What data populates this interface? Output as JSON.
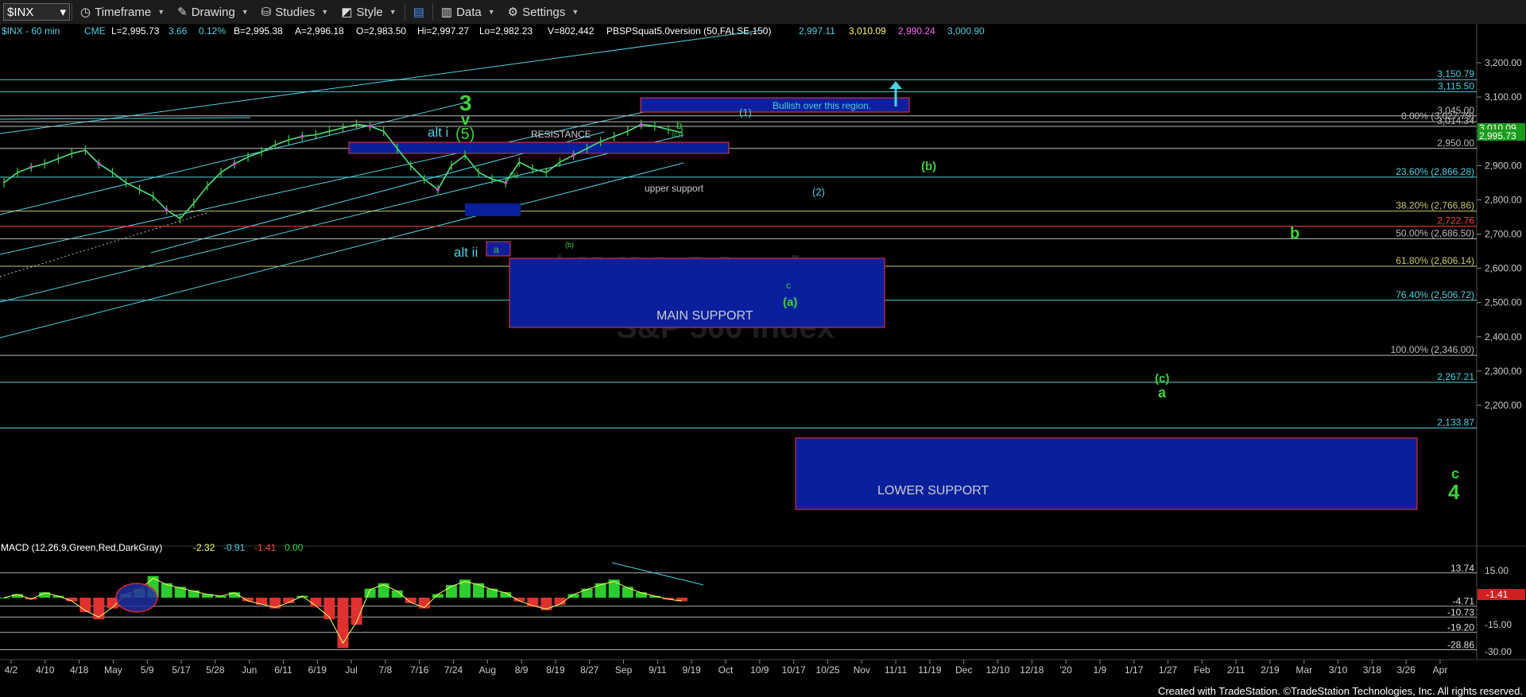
{
  "toolbar": {
    "symbol": "$INX",
    "timeframe": "Timeframe",
    "drawing": "Drawing",
    "studies": "Studies",
    "style": "Style",
    "data": "Data",
    "settings": "Settings"
  },
  "header": {
    "title": "$INX - 60 min",
    "exchange": "CME",
    "last": "L=2,995.73",
    "change": "3.66",
    "change_pct": "0.12%",
    "bid": "B=2,995.38",
    "ask": "A=2,996.18",
    "open": "O=2,983.50",
    "high": "Hi=2,997.27",
    "low": "Lo=2,982.23",
    "volume": "V=802,442",
    "study": "PBSPSquat5.0version (50,FALSE,150)",
    "study_v1": "2,997.11",
    "study_v2": "3,010.09",
    "study_v3": "2,990.24",
    "study_v4": "3,000.90"
  },
  "macd_header": {
    "label": "MACD (12,26,9,Green,Red,DarkGray)",
    "v1": "-2.32",
    "v2": "-0.91",
    "v3": "-1.41",
    "v4": "0.00"
  },
  "watermark": {
    "symbol": "$INX 60min",
    "name": "S&P 500 Index"
  },
  "zones": {
    "resistance": "RESISTANCE",
    "main_support": "MAIN SUPPORT",
    "lower_support": "LOWER SUPPORT",
    "bullish": "Bullish over this region.",
    "upper_support": "upper support"
  },
  "wave_labels": {
    "w3": "3",
    "wv": "v",
    "w5": "(5)",
    "alt_i": "alt i",
    "alt_ii": "alt ii",
    "wa_small": "a",
    "wb": "b",
    "wc_top": "(c)",
    "wa_small2": "(a)",
    "wb_small": "(b)",
    "w1": "(1)",
    "w2": "(2)",
    "wb_paren": "(b)",
    "wb_big": "b",
    "wc_mid": "c",
    "wa_paren": "(a)",
    "wc_paren": "(c)",
    "wa_big": "a",
    "wc_big": "c",
    "w4": "4"
  },
  "price_scale": {
    "ticks": [
      "3,200.00",
      "3,100.00",
      "3,000.00",
      "2,900.00",
      "2,800.00",
      "2,700.00",
      "2,600.00",
      "2,500.00",
      "2,400.00",
      "2,300.00",
      "2,200.00"
    ],
    "last_price": "2,995.73",
    "tag_green": "3,010.09"
  },
  "levels": [
    {
      "label": "3,150.79",
      "value": 3150.79,
      "color": "#4fd1e0"
    },
    {
      "label": "3,115.50",
      "value": 3115.5,
      "color": "#4fd1e0"
    },
    {
      "label": "3,045.00",
      "value": 3045.0,
      "color": "#bbbbbb"
    },
    {
      "label": "0.00% (3,027.79)",
      "value": 3027.79,
      "color": "#bbbbbb"
    },
    {
      "label": "3,014.34",
      "value": 3014.34,
      "color": "#bbbbbb"
    },
    {
      "label": "2,950.00",
      "value": 2950.0,
      "color": "#bbbbbb"
    },
    {
      "label": "23.60% (2,866.28)",
      "value": 2866.28,
      "color": "#4fd1e0"
    },
    {
      "label": "38.20% (2,766.86)",
      "value": 2766.86,
      "color": "#c8c864"
    },
    {
      "label": "2,722.76",
      "value": 2722.76,
      "color": "#ff4040"
    },
    {
      "label": "50.00% (2,686.50)",
      "value": 2686.5,
      "color": "#bbbbbb"
    },
    {
      "label": "61.80% (2,606.14)",
      "value": 2606.14,
      "color": "#c8c864"
    },
    {
      "label": "76.40% (2,506.72)",
      "value": 2506.72,
      "color": "#4fd1e0"
    },
    {
      "label": "100.00% (2,346.00)",
      "value": 2346.0,
      "color": "#bbbbbb"
    },
    {
      "label": "2,267.21",
      "value": 2267.21,
      "color": "#4fd1e0"
    },
    {
      "label": "2,133.87",
      "value": 2133.87,
      "color": "#4fd1e0"
    }
  ],
  "macd_scale": {
    "ticks": [
      "15.00",
      "-15.00",
      "-30.00"
    ],
    "levels": [
      {
        "label": "13.74",
        "value": 13.74
      },
      {
        "label": "-4.71",
        "value": -4.71
      },
      {
        "label": "-10.73",
        "value": -10.73
      },
      {
        "label": "-19.20",
        "value": -19.2
      },
      {
        "label": "-28.86",
        "value": -28.86
      }
    ],
    "last": "-1.41"
  },
  "x_axis": [
    "4/2",
    "4/10",
    "4/18",
    "May",
    "5/9",
    "5/17",
    "5/28",
    "Jun",
    "6/11",
    "6/19",
    "Jul",
    "7/8",
    "7/16",
    "7/24",
    "Aug",
    "8/9",
    "8/19",
    "8/27",
    "Sep",
    "9/11",
    "9/19",
    "Oct",
    "10/9",
    "10/17",
    "10/25",
    "Nov",
    "11/11",
    "11/19",
    "Dec",
    "12/10",
    "12/18",
    "'20",
    "1/9",
    "1/17",
    "1/27",
    "Feb",
    "2/11",
    "2/19",
    "Mar",
    "3/10",
    "3/18",
    "3/26",
    "Apr"
  ],
  "footer": "Created with TradeStation. ©TradeStation Technologies, Inc. All rights reserved.",
  "chart_data": {
    "type": "candlestick",
    "title": "$INX - 60 min",
    "ylim": [
      2100,
      3250
    ],
    "y_scale": "linear",
    "grid": false,
    "close_series": [
      2850,
      2880,
      2895,
      2905,
      2920,
      2935,
      2945,
      2905,
      2880,
      2850,
      2830,
      2810,
      2770,
      2745,
      2790,
      2840,
      2880,
      2905,
      2925,
      2940,
      2960,
      2975,
      2985,
      2990,
      3000,
      3010,
      3020,
      3015,
      3000,
      2950,
      2900,
      2860,
      2830,
      2900,
      2930,
      2880,
      2860,
      2850,
      2910,
      2890,
      2880,
      2910,
      2930,
      2950,
      2970,
      2985,
      3000,
      3020,
      3015,
      3005,
      2996
    ],
    "macd_series": [
      0,
      2,
      -1,
      3,
      1,
      -2,
      -8,
      -12,
      -6,
      2,
      5,
      12,
      8,
      6,
      4,
      2,
      1,
      3,
      -2,
      -4,
      -6,
      -3,
      1,
      -5,
      -12,
      -28,
      -15,
      5,
      8,
      4,
      -3,
      -6,
      2,
      7,
      10,
      8,
      5,
      3,
      -2,
      -5,
      -7,
      -4,
      2,
      5,
      8,
      10,
      6,
      3,
      1,
      -1,
      -2
    ],
    "range_label": "Apr 2019 to Apr 2020"
  }
}
